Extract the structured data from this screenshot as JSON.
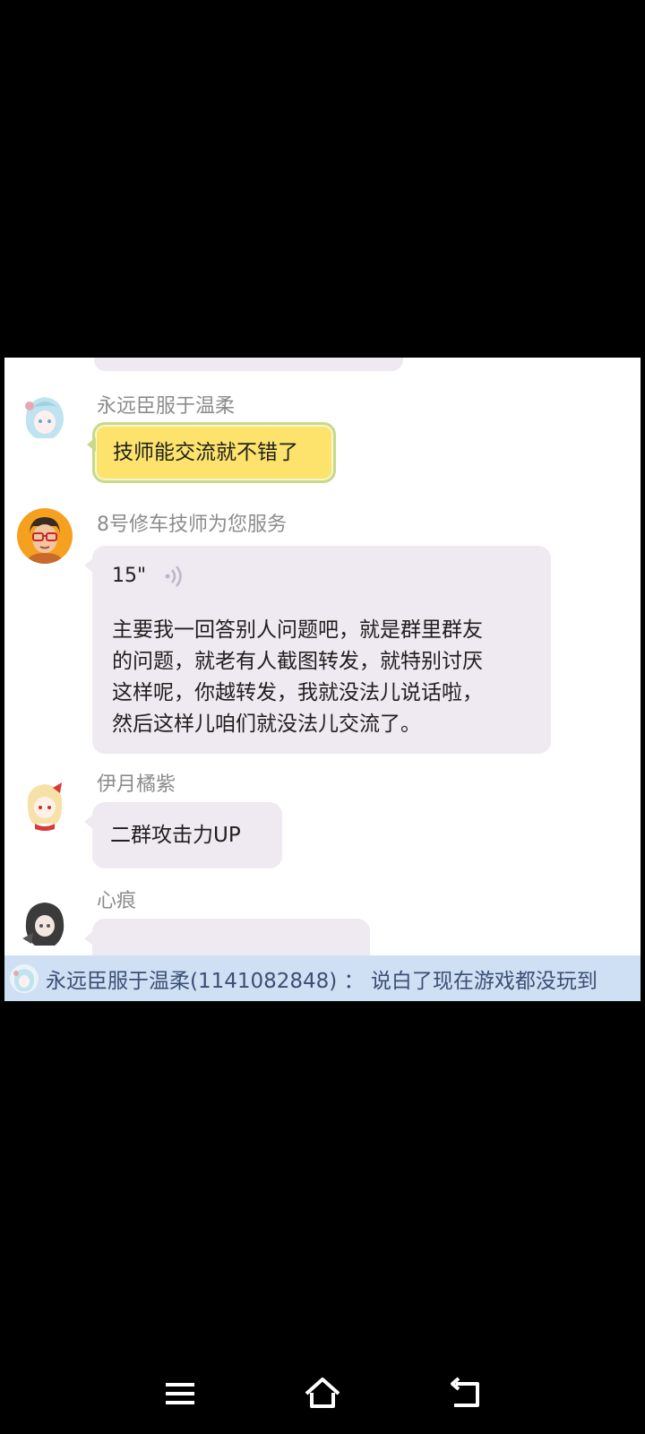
{
  "messages": [
    {
      "sender": "永远臣服于温柔",
      "text": "技师能交流就不错了"
    },
    {
      "sender": "8号修车技师为您服务",
      "voice_duration": "15\"",
      "transcript": [
        "主要我一回答别人问题吧，就是群里群友",
        "的问题，就老有人截图转发，就特别讨厌",
        "这样呢，你越转发，我就没法儿说话啦，",
        "然后这样儿咱们就没法儿交流了。"
      ]
    },
    {
      "sender": "伊月橘紫",
      "text": "二群攻击力UP"
    },
    {
      "sender": "心痕"
    }
  ],
  "notification": {
    "text": "永远臣服于温柔(1141082848) ： 说白了现在游戏都没玩到"
  },
  "nav": {
    "icons": [
      "menu-icon",
      "home-icon",
      "back-icon"
    ]
  }
}
